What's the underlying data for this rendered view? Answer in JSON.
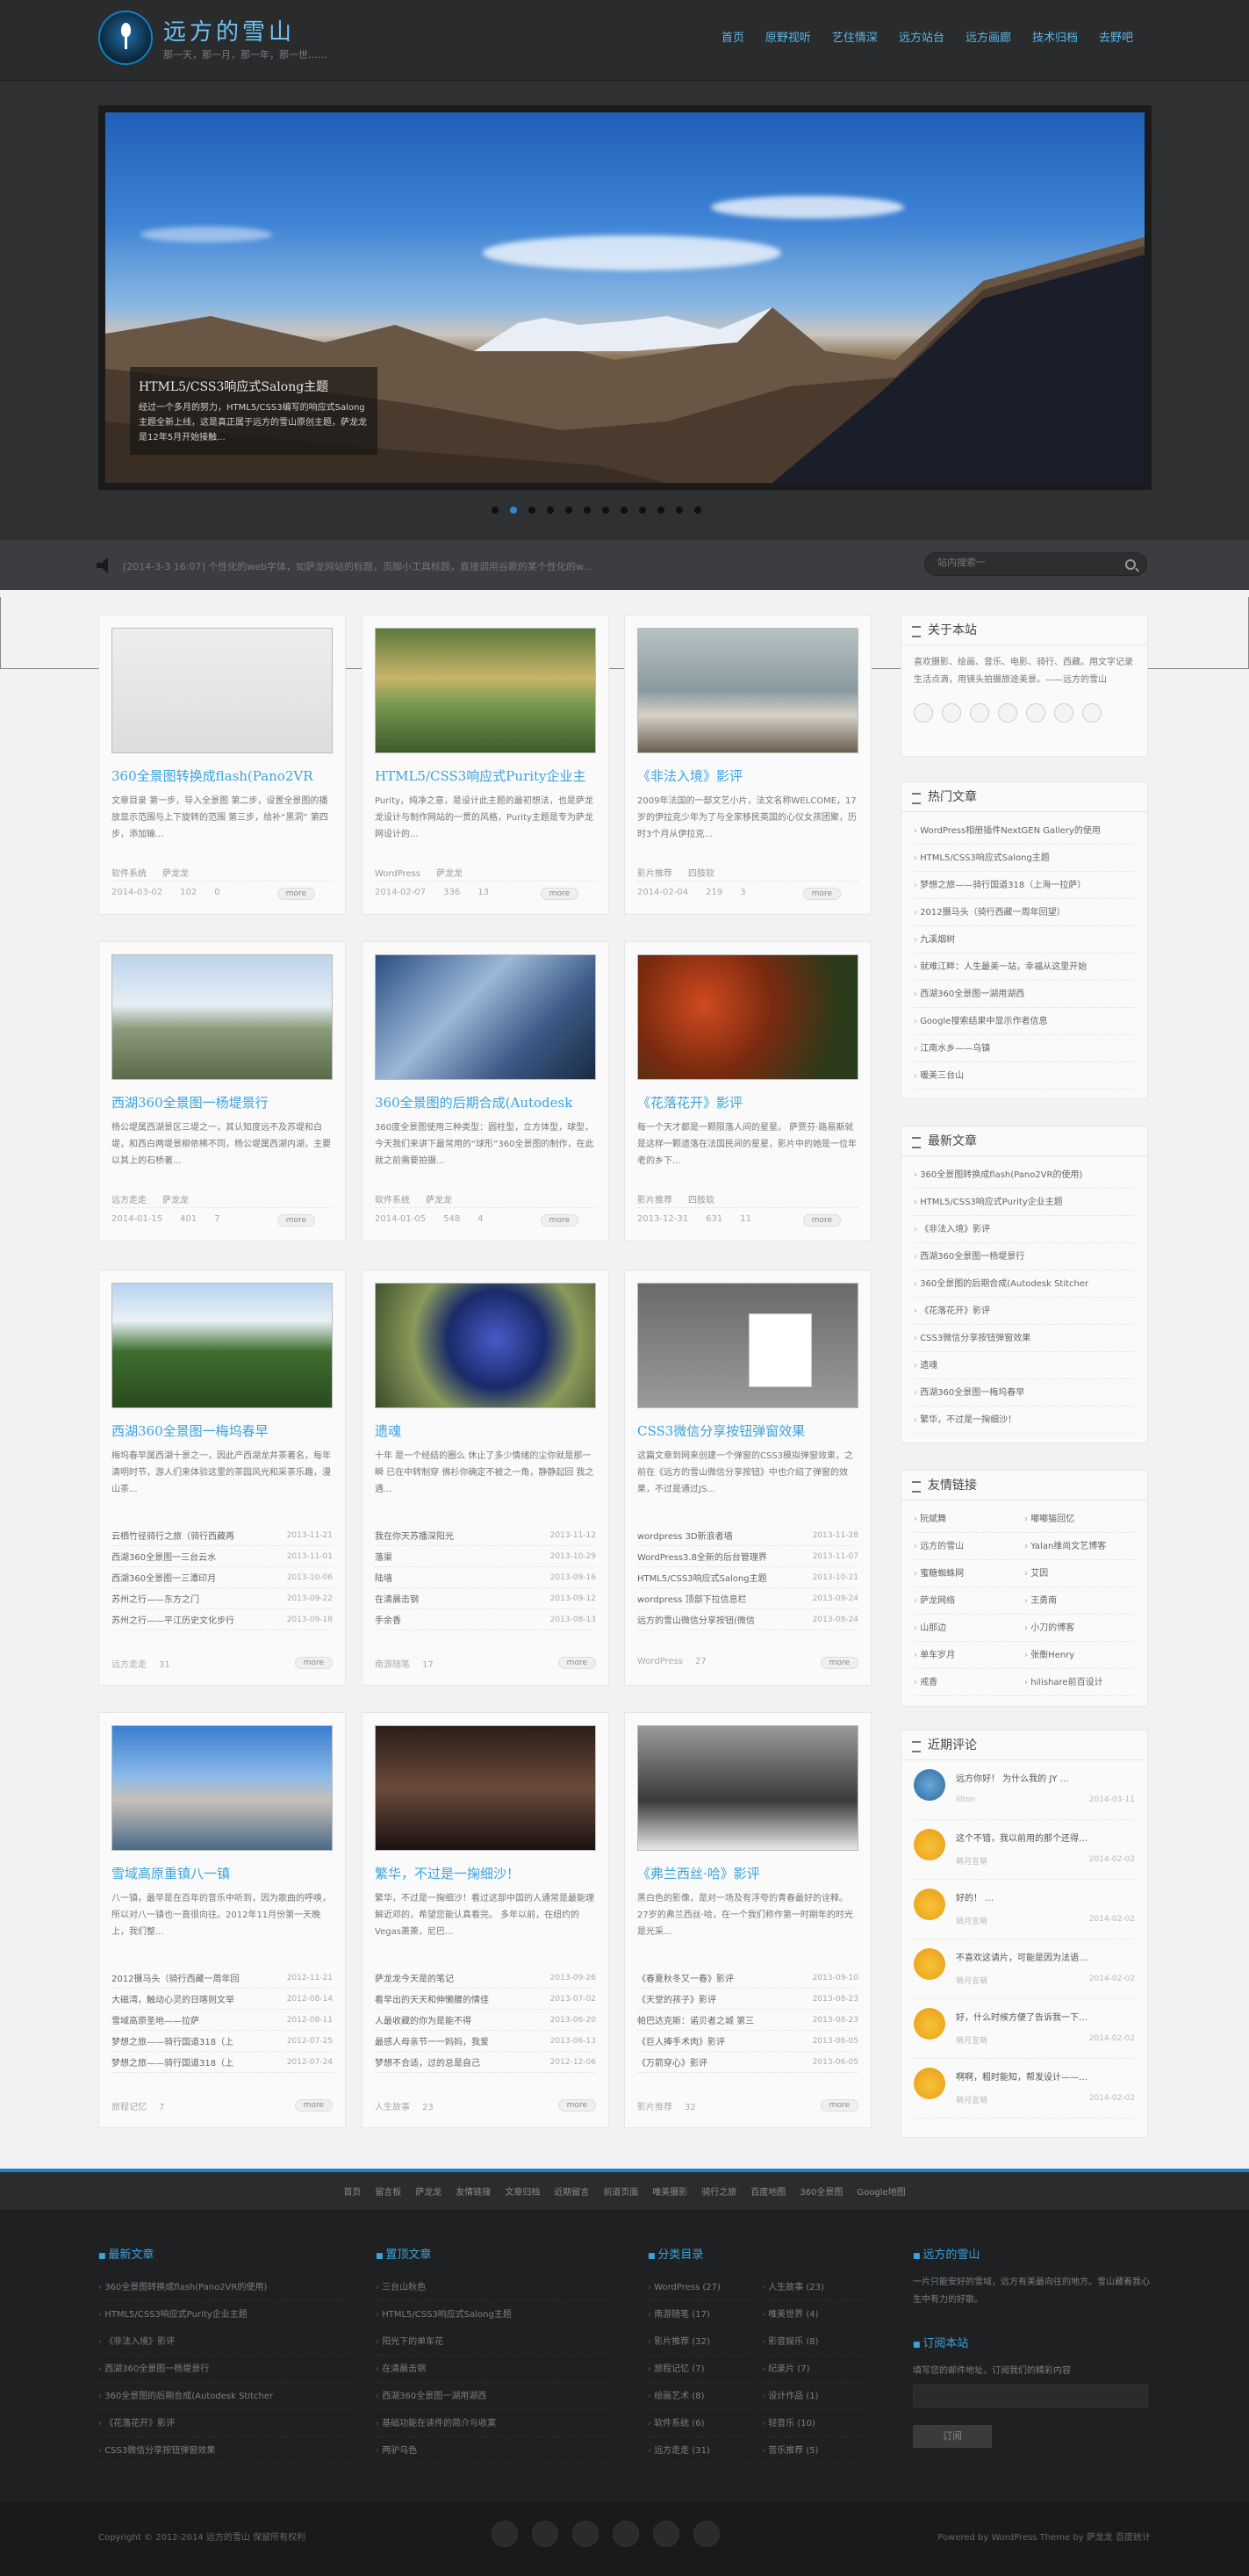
{
  "header": {
    "site_name": "远方的雪山",
    "site_desc": "那一天，那一月，那一年，那一世……",
    "nav": [
      "首页",
      "原野视听",
      "艺住情深",
      "远方站台",
      "远方画廊",
      "技术归档",
      "去野吧"
    ]
  },
  "slider": {
    "caption_title": "HTML5/CSS3响应式Salong主题",
    "caption_text": "经过一个多月的努力，HTML5/CSS3编写的响应式Salong主题全新上线，这是真正属于远方的雪山原创主题，萨龙龙是12年5月开始接触...",
    "dots": 12,
    "active_dot": 1
  },
  "notice": {
    "text": "[2014-3-3 16:07] 个性化的web字体，如萨龙网站的标题，页脚小工具标题，直接调用谷歌的某个性化的w...",
    "search_placeholder": "站内搜索一"
  },
  "posts": [
    {
      "title": "360全景图转换成flash(Pano2VR",
      "excerpt": "文章目录 第一步，导入全景图 第二步，设置全景图的播放显示范围与上下旋转的范围 第三步，给补“黑洞” 第四步，添加输...",
      "cat": "软件系统",
      "author": "萨龙龙",
      "date": "2014-03-02",
      "views": "102",
      "comments": "0",
      "more": "more"
    },
    {
      "title": "HTML5/CSS3响应式Purity企业主",
      "excerpt": "Purity，纯净之意，是设计此主题的最初想法，也是萨龙龙设计与制作网站的一贯的风格，Purity主题是专为萨龙网设计的...",
      "cat": "WordPress",
      "author": "萨龙龙",
      "date": "2014-02-07",
      "views": "336",
      "comments": "13",
      "more": "more"
    },
    {
      "title": "《非法入境》影评",
      "excerpt": "2009年法国的一部文艺小片，法文名称WELCOME，17岁的伊拉克少年为了与全家移民英国的心仪女孩团聚，历时3个月从伊拉克...",
      "cat": "影片推荐",
      "author": "四肢软",
      "date": "2014-02-04",
      "views": "219",
      "comments": "3",
      "more": "more"
    },
    {
      "title": "西湖360全景图一杨堤景行",
      "excerpt": "杨公堤属西湖景区三堤之一，其认知度远不及苏堤和白堤，和西白两堤景柳依稀不同，杨公堤属西湖内湖，主要以其上的石桥著...",
      "cat": "远方走走",
      "author": "萨龙龙",
      "date": "2014-01-15",
      "views": "401",
      "comments": "7",
      "more": "more"
    },
    {
      "title": "360全景图的后期合成(Autodesk",
      "excerpt": "360度全景图使用三种类型：圆柱型，立方体型，球型，今天我们来讲下最常用的“球形”360全景图的制作，在此就之前需要拍摄...",
      "cat": "软件系统",
      "author": "萨龙龙",
      "date": "2014-01-05",
      "views": "548",
      "comments": "4",
      "more": "more"
    },
    {
      "title": "《花落花开》影评",
      "excerpt": "每一个天才都是一颗陨落人间的星星。 萨贾芬·路易斯就是这样一颗遗落在法国民间的星星，影片中的她是一位年老的乡下...",
      "cat": "影片推荐",
      "author": "四肢软",
      "date": "2013-12-31",
      "views": "631",
      "comments": "11",
      "more": "more"
    },
    {
      "title": "西湖360全景图一梅坞春早",
      "excerpt": "梅坞春早属西湖十景之一，因此产西湖龙井茶著名，每年清明时节，游人们来体验这里的茶园风光和采茶乐趣，漫山茶...",
      "cat": "远方走走",
      "count": "31",
      "list": [
        [
          "云栖竹径骑行之旅（骑行西藏再",
          "2013-11-21"
        ],
        [
          "西湖360全景图一三台云水",
          "2013-11-01"
        ],
        [
          "西湖360全景图一三潭印月",
          "2013-10-06"
        ],
        [
          "苏州之行——东方之门",
          "2013-09-22"
        ],
        [
          "苏州之行——平江历史文化步行",
          "2013-09-18"
        ]
      ]
    },
    {
      "title": "遗魂",
      "excerpt": "十年 是一个经结的圈么 休止了多少情绪的尘你就是那一瞬 已在中转制穿 佛衫你确定不被之一角，静静起回 我之遇...",
      "cat": "南游随笔",
      "count": "17",
      "list": [
        [
          "我在你天苏播深阳光",
          "2013-11-12"
        ],
        [
          "落渠",
          "2013-10-29"
        ],
        [
          "陆墙",
          "2013-09-16"
        ],
        [
          "在清晨击钢",
          "2013-09-12"
        ],
        [
          "手余香",
          "2013-08-13"
        ]
      ]
    },
    {
      "title": "CSS3微信分享按钮弹窗效果",
      "excerpt": "这篇文章到网来创建一个弹窗的CSS3模拟弹窗效果，之前在《远方的雪山微信分享按钮》中也介绍了弹窗的效果，不过是通过JS...",
      "cat": "WordPress",
      "count": "27",
      "list": [
        [
          "wordpress 3D新浪者墙",
          "2013-11-28"
        ],
        [
          "WordPress3.8全新的后台管理界",
          "2013-11-07"
        ],
        [
          "HTML5/CSS3响应式Salong主题",
          "2013-10-21"
        ],
        [
          "wordpress 顶部下拉信息栏",
          "2013-09-24"
        ],
        [
          "远方的雪山微信分享按钮(微信",
          "2013-08-24"
        ]
      ]
    },
    {
      "title": "雪域高原重镇八一镇",
      "excerpt": "八一镇，最早是在百年的音乐中听到，因为歌曲的呼唤，所以对八一镇也一直很向往。2012年11月份第一天晚上，我们整...",
      "cat": "旅程记忆",
      "count": "7",
      "list": [
        [
          "2012摄马头（骑行西藏一周年回",
          "2012-11-21"
        ],
        [
          "大磁湾，触动心灵的日喀则文举",
          "2012-08-14"
        ],
        [
          "雪域高原圣地——拉萨",
          "2012-08-11"
        ],
        [
          "梦想之旅——骑行国道318（上",
          "2012-07-25"
        ],
        [
          "梦想之旅——骑行国道318（上",
          "2012-07-24"
        ]
      ]
    },
    {
      "title": "繁华，不过是一掬细沙！",
      "excerpt": "繁华，不过是一掬细沙！看过这部中国的人通常是最能理解近邓的，希望您能认真看完。 多年以前，在纽约的Vegas萧萧，尼巴...",
      "cat": "人生故事",
      "count": "23",
      "list": [
        [
          "萨龙龙今天是的笔记",
          "2013-09-26"
        ],
        [
          "看早出的天天和伸懒腰的情佳",
          "2013-07-02"
        ],
        [
          "人最收藏的你为是能不得",
          "2013-06-20"
        ],
        [
          "最感人母亲节一一妈妈，我爱",
          "2013-06-13"
        ],
        [
          "梦想不合适，过的总是自己",
          "2012-12-06"
        ]
      ]
    },
    {
      "title": "《弗兰西丝·哈》影评",
      "excerpt": "黑白色的影像，是对一场及有浮夸的青春最好的诠释。 27岁的弗兰西丝·哈，在一个我们称作第一时期年的时光是光采...",
      "cat": "影片推荐",
      "count": "32",
      "list": [
        [
          "《春夏秋冬又一春》影评",
          "2013-09-10"
        ],
        [
          "《天堂的孩子》影评",
          "2013-08-23"
        ],
        [
          "帕巴达克斯：诺贝者之城 第三",
          "2013-08-23"
        ],
        [
          "《巨人捧手术肉》影评",
          "2013-06-05"
        ],
        [
          "《万箭穿心》影评",
          "2013-06-05"
        ]
      ]
    }
  ],
  "sidebar": {
    "about_title": "关于本站",
    "about_text": "喜欢摄影、绘画、音乐、电影、骑行、西藏。用文字记录生活点滴，用镜头拍摄旅途美景。——远方的雪山",
    "hot_title": "热门文章",
    "hot": [
      "WordPress相册插件NextGEN Gallery的使用",
      "HTML5/CSS3响应式Salong主题",
      "梦想之旅——骑行国道318（上海一拉萨）",
      "2012摄马头（骑行西藏一周年回望）",
      "九溪烟树",
      "就难江畔：人生最美一站，幸福从这里开始",
      "西湖360全景图一湖用湖西",
      "Google搜索结果中显示作者信息",
      "江南水乡——乌镇",
      "暖美三台山"
    ],
    "new_title": "最新文章",
    "new": [
      "360全景图转换成flash(Pano2VR的使用)",
      "HTML5/CSS3响应式Purity企业主题",
      "《非法入境》影评",
      "西湖360全景图一杨堤景行",
      "360全景图的后期合成(Autodesk Stitcher",
      "《花落花开》影评",
      "CSS3微信分享按钮弹窗效果",
      "遗魂",
      "西湖360全景图一梅坞春早",
      "繁华，不过是一掬细沙！"
    ],
    "links_title": "友情链接",
    "links": [
      "阮斌舞",
      "嘟嘟猫回忆",
      "远方的雪山",
      "Yalan维尚文艺博客",
      "蜜糖蜘蛛网",
      "艾因",
      "萨龙网络",
      "王勇南",
      "山那边",
      "小刀的博客",
      "单车岁月",
      "张衡Henry",
      "戒香",
      "hilishare前百设计"
    ],
    "comments_title": "近期评论",
    "comments": [
      [
        "远方你好！ 为什么我的 JY …",
        "lilton",
        "2014-03-11"
      ],
      [
        "这个不错，我以前用的那个还得…",
        "萌月宜萌",
        "2014-02-02"
      ],
      [
        "好的！ …",
        "萌月宜萌",
        "2014-02-02"
      ],
      [
        "不喜欢这请片，可能是因为法语…",
        "萌月宜萌",
        "2014-02-02"
      ],
      [
        "好，什么时候方便了告诉我一下…",
        "萌月宜萌",
        "2014-02-02"
      ],
      [
        "啊啊，粗时能知，帮发设计——…",
        "萌月宜萌",
        "2014-02-02"
      ]
    ]
  },
  "footer": {
    "links": [
      "首页",
      "留言板",
      "萨龙龙",
      "友情链接",
      "文章归档",
      "近期留言",
      "前道页面",
      "唯美摄影",
      "骑行之旅",
      "百度地图",
      "360全景图",
      "Google地图"
    ],
    "new_title": "最新文章",
    "new": [
      "360全景图转换成flash(Pano2VR的使用)",
      "HTML5/CSS3响应式Purity企业主题",
      "《非法入境》影评",
      "西湖360全景图一杨堤景行",
      "360全景图的后期合成(Autodesk Stitcher",
      "《花落花开》影评",
      "CSS3微信分享按钮弹窗效果"
    ],
    "hot_title": "置顶文章",
    "hot": [
      "三台山秋色",
      "HTML5/CSS3响应式Salong主题",
      "阳光下的单车花",
      "在清晨击钢",
      "西湖360全景图一湖用湖西",
      "基础功能在读件的简介与收寞",
      "两驴乌色"
    ],
    "cat_title": "分类目录",
    "cats": [
      "WordPress (27)",
      "人生故事 (23)",
      "南游随笔 (17)",
      "唯美世界 (4)",
      "影片推荐 (32)",
      "影音娱乐 (8)",
      "旅程记忆 (7)",
      "纪录片 (7)",
      "绘画艺术 (8)",
      "设计作品 (1)",
      "软件系统 (6)",
      "轻音乐 (10)",
      "远方走走 (31)",
      "音乐推荐 (5)"
    ],
    "about_title": "远方的雪山",
    "about_text": "一片只能安好的雪域，远方有美最向往的地方。雪山藏着我心生中有力的好歌。",
    "sub_title": "订阅本站",
    "sub_text": "填写您的邮件地址，订阅我们的精彩内容",
    "sub_button": "订阅",
    "copyright": "Copyright © 2012-2014 远方的雪山 保留所有权利",
    "powered": "Powered by WordPress Theme by 萨龙龙 百度统计"
  }
}
